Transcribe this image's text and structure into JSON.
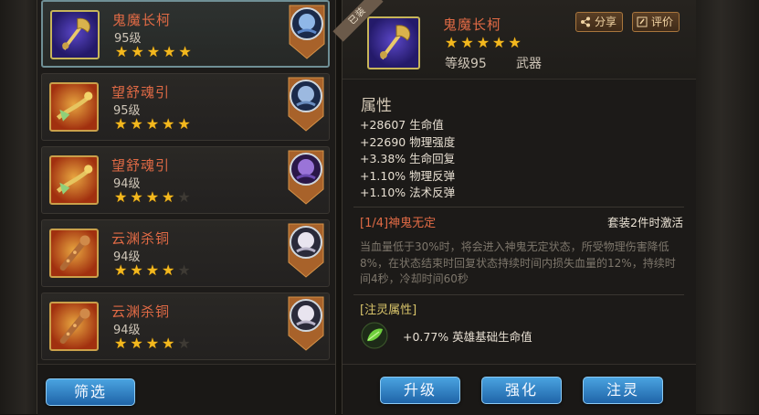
{
  "items": [
    {
      "name": "鬼魔长柯",
      "level": "95级",
      "stars": 5,
      "icon": "golden-axe-icon",
      "icon_bg": "purple",
      "hero": "blue-hero-portrait",
      "selected": true
    },
    {
      "name": "望舒魂引",
      "level": "95级",
      "stars": 5,
      "icon": "golden-dragon-staff-icon",
      "icon_bg": "orange",
      "hero": "blue-hero-portrait",
      "selected": false
    },
    {
      "name": "望舒魂引",
      "level": "94级",
      "stars": 4,
      "icon": "golden-dragon-staff-icon",
      "icon_bg": "orange",
      "hero": "purple-hero-portrait",
      "selected": false
    },
    {
      "name": "云渊杀铜",
      "level": "94级",
      "stars": 4,
      "icon": "bronze-mace-icon",
      "icon_bg": "orange",
      "hero": "white-hair-hero-portrait",
      "selected": false
    },
    {
      "name": "云渊杀铜",
      "level": "94级",
      "stars": 4,
      "icon": "bronze-mace-icon",
      "icon_bg": "orange",
      "hero": "white-hair-hero-portrait",
      "selected": false
    }
  ],
  "filter_button": "筛选",
  "detail": {
    "ribbon": "已装",
    "name": "鬼魔长柯",
    "stars": 5,
    "level": "等级95",
    "type": "武器",
    "share_label": "分享",
    "review_label": "评价",
    "section_title": "属性",
    "attributes": [
      "+28607 生命值",
      "+22690 物理强度",
      "+3.38% 生命回复",
      "+1.10% 物理反弹",
      "+1.10% 法术反弹"
    ],
    "set_title": "[1/4]神鬼无定",
    "set_activate": "套装2件时激活",
    "set_description": "当血量低于30%时，将会进入神鬼无定状态，所受物理伤害降低8%，在状态结束时回复状态持续时间内损失血量的12%，持续时间4秒，冷却时间60秒",
    "infuse_title": "[注灵属性]",
    "infuse_value": "+0.77% 英雄基础生命值"
  },
  "actions": {
    "upgrade": "升级",
    "enhance": "强化",
    "infuse": "注灵"
  },
  "colors": {
    "item_name": "#e06a45",
    "star": "#f3b81e",
    "button_blue": "#2f86cf",
    "infuse_gold": "#d8c46a"
  }
}
